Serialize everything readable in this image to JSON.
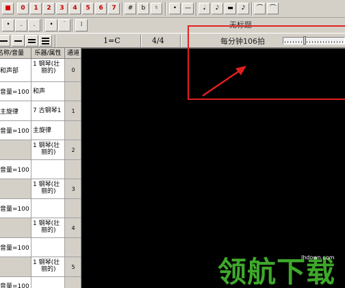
{
  "toolbar": {
    "color_buttons": [
      "■",
      "0",
      "1",
      "2",
      "3",
      "4",
      "5",
      "6",
      "7"
    ],
    "accidentals": [
      "#",
      "b",
      "♮"
    ],
    "durations": [
      "•",
      "—"
    ],
    "note_values": [
      "𝅘𝅥",
      "𝅘𝅥𝅮",
      "▬",
      "𝅘𝅥𝅯"
    ],
    "slurs": [
      "⌒",
      "⌒"
    ]
  },
  "toolbar2": {
    "buttons": [
      "•",
      ".",
      ".",
      "•",
      "˙",
      "⁞"
    ]
  },
  "document": {
    "title": "无标题"
  },
  "toolbar3": {
    "key_signature": "1=C",
    "time_signature": "4/4",
    "tempo_label": "每分钟106拍",
    "tempo_bpm": 106
  },
  "track_table": {
    "headers": [
      "名称/音量",
      "乐器/属性",
      "通道"
    ],
    "rows": [
      {
        "name": "和声部",
        "instrument": [
          "1 钢琴(壮",
          "丽的)"
        ],
        "channel": "0",
        "grey": false,
        "h": 34
      },
      {
        "name": "音量=100",
        "instrument": [
          "和声"
        ],
        "channel": "",
        "grey": false,
        "h": 28
      },
      {
        "name": "主旋律",
        "instrument": [
          "7 古钢琴1"
        ],
        "channel": "1",
        "grey": false,
        "h": 29
      },
      {
        "name": "音量=100",
        "instrument": [
          "主旋律"
        ],
        "channel": "",
        "grey": false,
        "h": 28
      },
      {
        "name": "",
        "instrument": [
          "1 钢琴(壮",
          "丽的)"
        ],
        "channel": "2",
        "grey": true,
        "h": 29
      },
      {
        "name": "音量=100",
        "instrument": [
          ""
        ],
        "channel": "",
        "grey": false,
        "h": 28
      },
      {
        "name": "",
        "instrument": [
          "1 钢琴(壮",
          "丽的)"
        ],
        "channel": "3",
        "grey": true,
        "h": 29
      },
      {
        "name": "音量=100",
        "instrument": [
          ""
        ],
        "channel": "",
        "grey": false,
        "h": 28
      },
      {
        "name": "",
        "instrument": [
          "1 钢琴(壮",
          "丽的)"
        ],
        "channel": "4",
        "grey": true,
        "h": 29
      },
      {
        "name": "音量=100",
        "instrument": [
          ""
        ],
        "channel": "",
        "grey": false,
        "h": 28
      },
      {
        "name": "",
        "instrument": [
          "1 钢琴(壮",
          "丽的)"
        ],
        "channel": "5",
        "grey": true,
        "h": 29
      },
      {
        "name": "音量=100",
        "instrument": [
          ""
        ],
        "channel": "",
        "grey": false,
        "h": 26
      }
    ]
  },
  "watermark": {
    "logo_text": "领航下载",
    "url": "lhdown.com"
  },
  "colors": {
    "annotation": "#e02020",
    "watermark": "#3ea82b",
    "score_bg": "#000000"
  }
}
